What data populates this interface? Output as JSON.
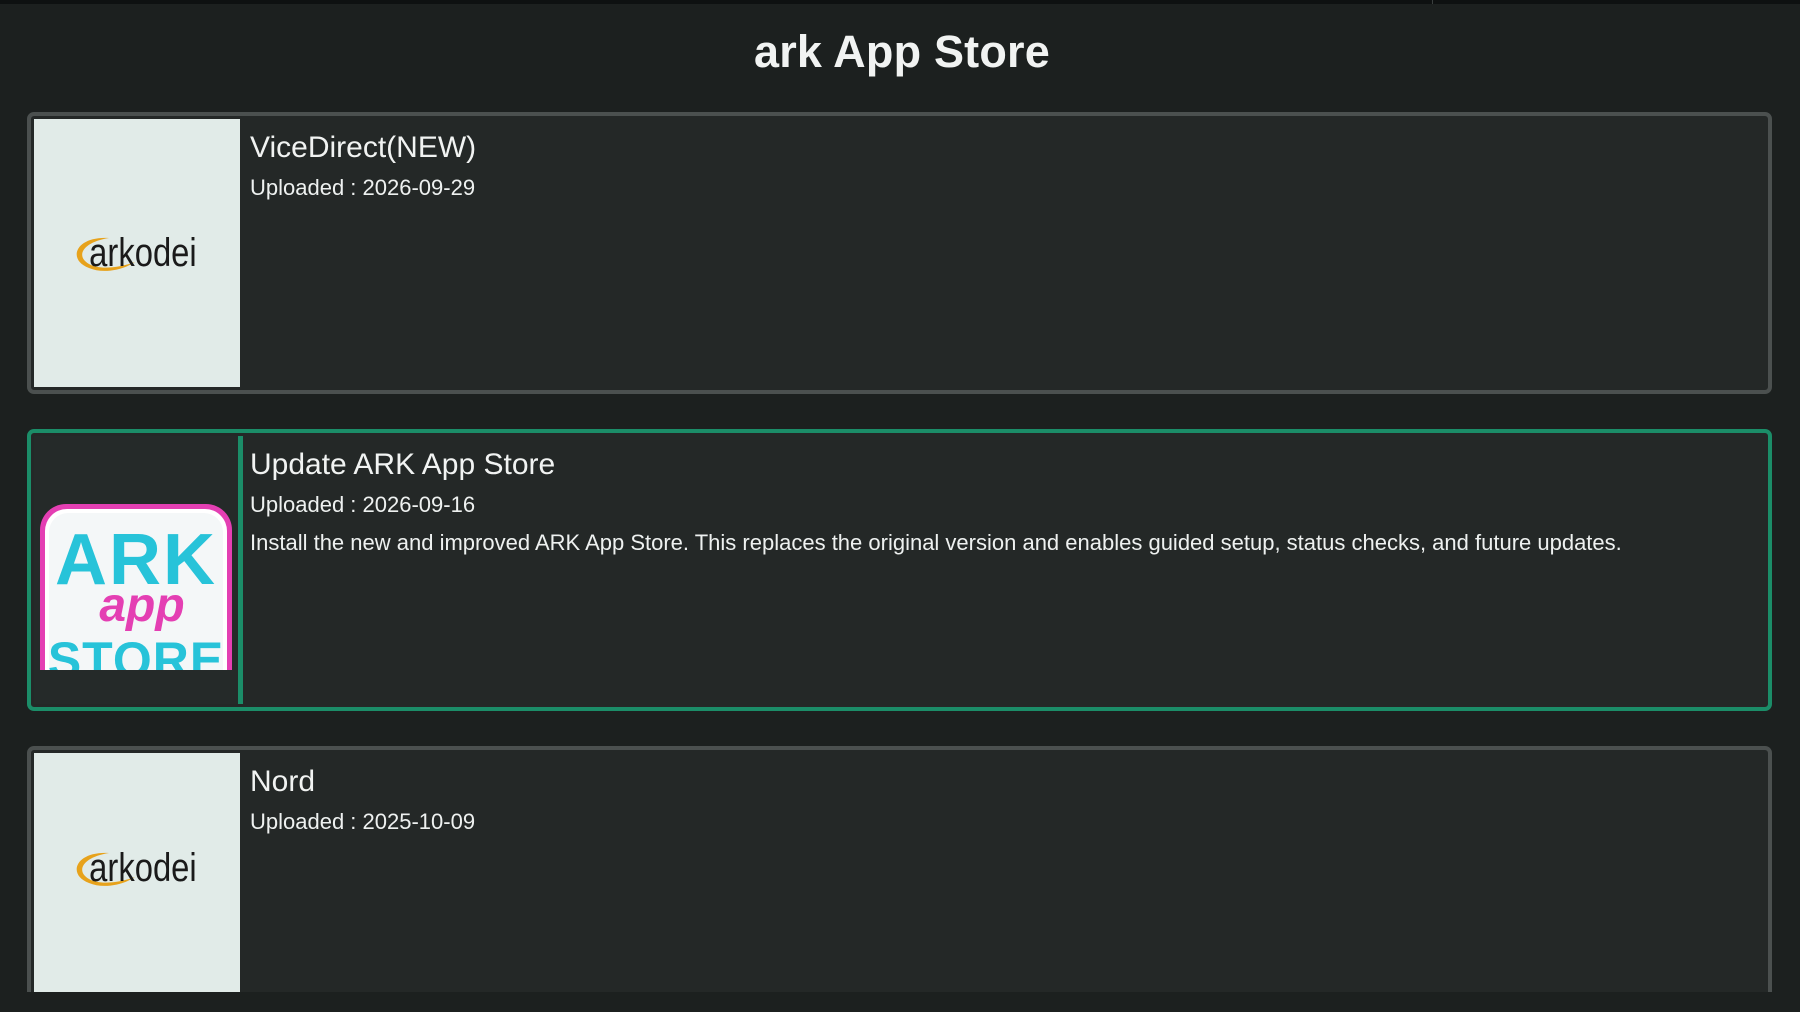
{
  "header": {
    "title": "ark App Store"
  },
  "apps": [
    {
      "name": "ViceDirect(NEW)",
      "uploaded": "Uploaded : 2026-09-29",
      "description": "",
      "logo": "arkodei",
      "selected": false
    },
    {
      "name": "Update ARK App Store",
      "uploaded": "Uploaded : 2026-09-16",
      "description": "Install the new and improved ARK App Store. This replaces the original version and enables guided setup, status checks, and future updates.",
      "logo": {
        "line1": "ARK",
        "line2": "app",
        "line3": "STORE"
      },
      "selected": true
    },
    {
      "name": "Nord",
      "uploaded": "Uploaded : 2025-10-09",
      "description": "",
      "logo": "arkodei",
      "selected": false
    }
  ],
  "colors": {
    "background": "#1c201f",
    "card": "#242827",
    "card_border": "#4b504f",
    "focus": "#1b8d68",
    "logo_orange": "#e7a21b",
    "logo_cyan": "#27c3d9",
    "logo_magenta": "#e43fb3"
  }
}
